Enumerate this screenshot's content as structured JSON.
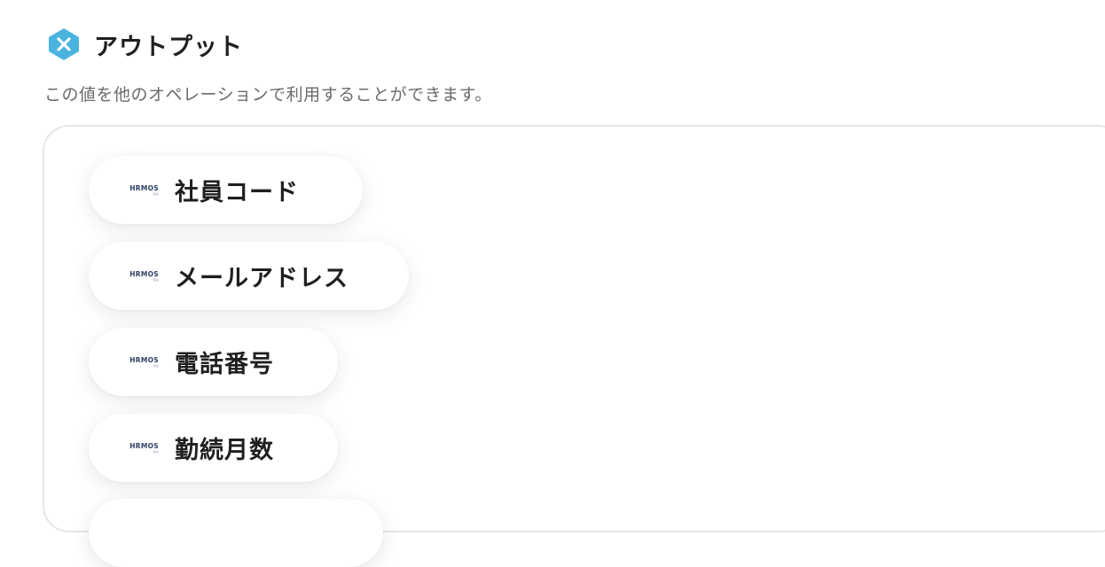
{
  "header": {
    "title": "アウトプット",
    "subtitle": "この値を他のオペレーションで利用することができます。",
    "icon": "yoom-x-icon",
    "icon_color": "#4ab3e0"
  },
  "outputs": {
    "items": [
      {
        "label": "社員コード",
        "logo_text": "HRMOS",
        "logo_sub": "勤怠"
      },
      {
        "label": "メールアドレス",
        "logo_text": "HRMOS",
        "logo_sub": "勤怠"
      },
      {
        "label": "電話番号",
        "logo_text": "HRMOS",
        "logo_sub": "勤怠"
      },
      {
        "label": "勤続月数",
        "logo_text": "HRMOS",
        "logo_sub": "勤怠"
      }
    ]
  }
}
